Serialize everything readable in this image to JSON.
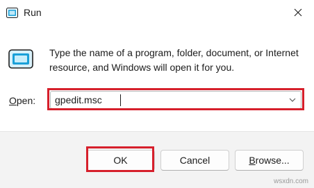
{
  "window": {
    "title": "Run",
    "title_icon": "run-icon",
    "close_icon": "close-icon"
  },
  "body": {
    "icon": "run-app-icon",
    "description": "Type the name of a program, folder, document, or Internet resource, and Windows will open it for you."
  },
  "open_field": {
    "label_access_key": "O",
    "label_rest": "pen:",
    "value": "gpedit.msc",
    "dropdown_icon": "chevron-down-icon"
  },
  "buttons": {
    "ok": "OK",
    "cancel": "Cancel",
    "browse_access_key": "B",
    "browse_rest": "rowse..."
  },
  "watermark": "wsxdn.com",
  "colors": {
    "highlight": "#d61f2b",
    "footer_bg": "#f3f3f3",
    "icon_accent": "#1aa0d8"
  }
}
